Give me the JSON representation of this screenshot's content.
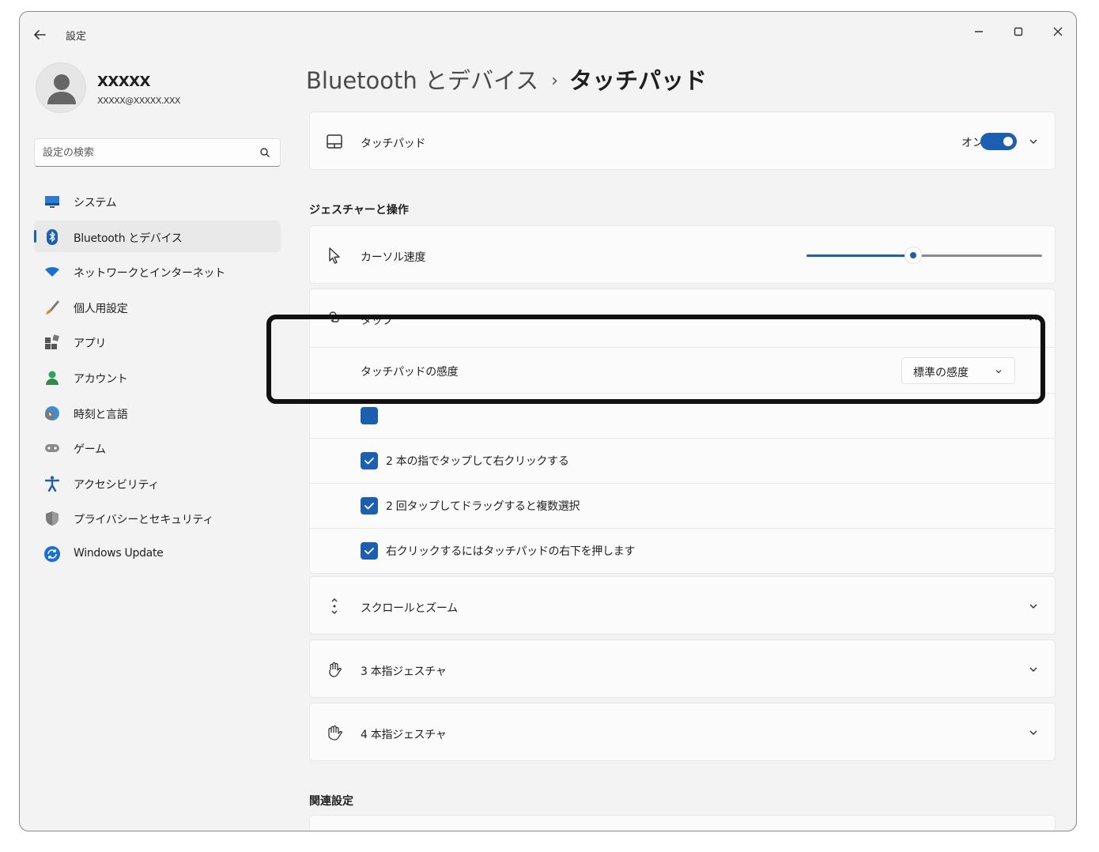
{
  "window": {
    "title": "設定",
    "controls": {
      "minimize": "–",
      "maximize": "▢",
      "close": "✕"
    }
  },
  "user": {
    "name": "XXXXX",
    "email": "XXXXX@XXXXX.XXX"
  },
  "search": {
    "placeholder": "設定の検索"
  },
  "sidebar": {
    "items": [
      {
        "label": "システム",
        "icon": "monitor-icon",
        "active": false
      },
      {
        "label": "Bluetooth とデバイス",
        "icon": "bluetooth-icon",
        "active": true
      },
      {
        "label": "ネットワークとインターネット",
        "icon": "wifi-icon",
        "active": false
      },
      {
        "label": "個人用設定",
        "icon": "brush-icon",
        "active": false
      },
      {
        "label": "アプリ",
        "icon": "apps-icon",
        "active": false
      },
      {
        "label": "アカウント",
        "icon": "person-icon",
        "active": false
      },
      {
        "label": "時刻と言語",
        "icon": "globe-clock-icon",
        "active": false
      },
      {
        "label": "ゲーム",
        "icon": "gamepad-icon",
        "active": false
      },
      {
        "label": "アクセシビリティ",
        "icon": "accessibility-icon",
        "active": false
      },
      {
        "label": "プライバシーとセキュリティ",
        "icon": "shield-icon",
        "active": false
      },
      {
        "label": "Windows Update",
        "icon": "update-icon",
        "active": false
      }
    ]
  },
  "breadcrumb": {
    "parent": "Bluetooth とデバイス",
    "separator": "›",
    "current": "タッチパッド"
  },
  "touchpad": {
    "label": "タッチパッド",
    "toggle_label": "オン",
    "toggle_on": true
  },
  "gestures": {
    "section_title": "ジェスチャーと操作",
    "cursor_speed": {
      "label": "カーソル速度",
      "value_fraction": 0.45
    },
    "taps": {
      "label": "タップ",
      "expanded": true,
      "sensitivity": {
        "label": "タッチパッドの感度",
        "value": "標準の感度"
      },
      "options": [
        {
          "label": "2 本の指でタップして右クリックする",
          "checked": true
        },
        {
          "label": "2 回タップしてドラッグすると複数選択",
          "checked": true
        },
        {
          "label": "右クリックするにはタッチパッドの右下を押します",
          "checked": true
        }
      ]
    },
    "scroll_zoom": {
      "label": "スクロールとズーム"
    },
    "three_finger": {
      "label": "3 本指ジェスチャ"
    },
    "four_finger": {
      "label": "4 本指ジェスチャ"
    }
  },
  "related": {
    "section_title": "関連設定"
  },
  "colors": {
    "accent": "#1c5fb0",
    "background": "#f3f3f3",
    "card": "#fbfbfb"
  }
}
